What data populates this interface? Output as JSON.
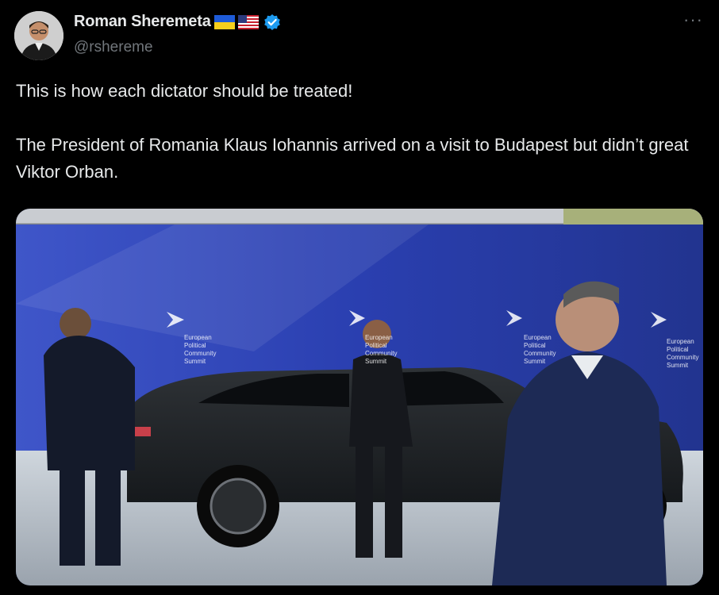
{
  "tweet": {
    "author": {
      "display_name": "Roman Sheremeta",
      "handle": "@rshereme",
      "badges": [
        "ukraine-flag-icon",
        "us-flag-icon",
        "verified-badge-icon"
      ]
    },
    "more_icon": "more-options-icon",
    "text": "This is how each dictator should be treated!\n\nThe President of Romania Klaus Iohannis arrived on a visit to Budapest but didn’t great Viktor Orban.",
    "media": {
      "type": "video-still",
      "backdrop_lines": [
        "European",
        "Political",
        "Community",
        "Summit"
      ]
    }
  },
  "colors": {
    "background": "#000000",
    "text_primary": "#e7e9ea",
    "text_secondary": "#71767b",
    "verified": "#1d9bf0",
    "backdrop_blue": "#2a3ea8"
  }
}
